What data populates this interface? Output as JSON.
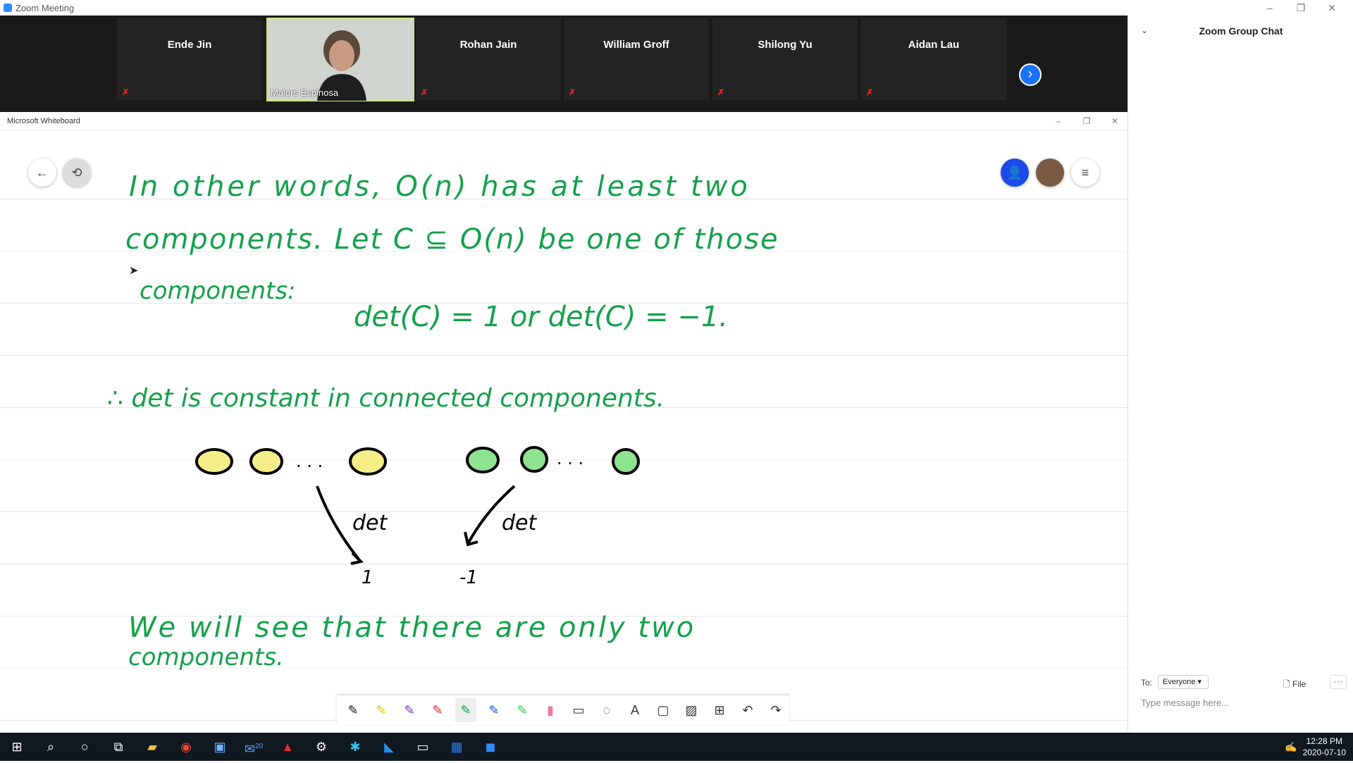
{
  "zoom": {
    "window_title": "Zoom Meeting",
    "participants": [
      {
        "name": "Ende Jin",
        "muted": true
      },
      {
        "name": "Malors Espinosa",
        "muted": false,
        "video": true
      },
      {
        "name": "Rohan Jain",
        "muted": true
      },
      {
        "name": "William Groff",
        "muted": true
      },
      {
        "name": "Shilong Yu",
        "muted": true
      },
      {
        "name": "Aidan Lau",
        "muted": true
      }
    ]
  },
  "chat": {
    "title": "Zoom Group Chat",
    "to_label": "To:",
    "recipient": "Everyone",
    "file_label": "File",
    "more_label": "···",
    "placeholder": "Type message here..."
  },
  "whiteboard": {
    "window_title": "Microsoft Whiteboard",
    "lines": [
      "In other words, O(n) has at least two",
      "components. Let C ⊆ O(n) be one of those",
      "components:",
      "det(C) = 1   or   det(C) = −1.",
      "∴ det is constant in connected components.",
      "det",
      "det",
      "1",
      "-1",
      "We will see that there are only two",
      "components."
    ],
    "ink_color": "#14a04a"
  },
  "taskbar": {
    "time": "12:28 PM",
    "date": "2020-07-10",
    "mail_badge": "20"
  }
}
